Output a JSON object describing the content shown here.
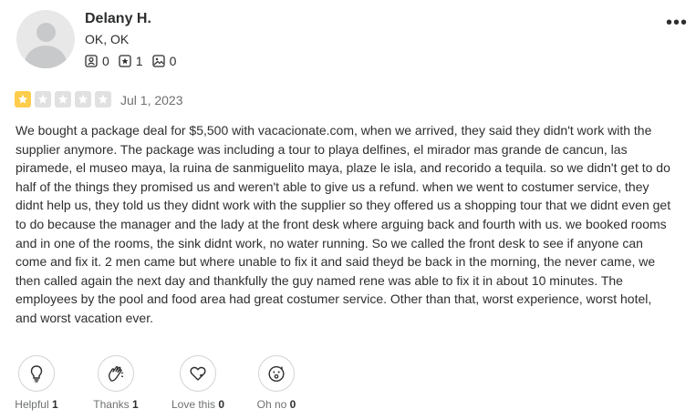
{
  "reviewer": {
    "name": "Delany H.",
    "location": "OK, OK",
    "friends_count": "0",
    "reviews_count": "1",
    "photos_count": "0"
  },
  "review": {
    "rating": 1,
    "rating_max": 5,
    "star_active_color": "#ffcc4b",
    "star_inactive_color": "#e1e1e1",
    "date": "Jul 1, 2023",
    "text": "We bought a package deal for $5,500 with vacacionate.com, when we arrived, they said they didn't work with the supplier anymore. The package was including a tour to playa delfines, el mirador mas grande de cancun, las piramede, el museo maya, la ruina de sanmiguelito maya, plaze le isla, and recorido a tequila. so we didn't get to do half of the things they promised us and weren't able to give us a refund. when we went to costumer service, they didnt help us, they told us they didnt work with the supplier so they offered us a shopping tour that we didnt even get to do because the manager and the lady at the front desk where arguing back and fourth with us. we booked rooms and in one of the rooms, the sink didnt work, no water running. So we called the front desk to see if anyone can come and fix it. 2 men came but where unable to fix it and said theyd be back in the morning, the never came, we then called again the next day and thankfully the guy named rene was able to fix it in about 10 minutes. The employees by the pool and food area had great costumer service. Other than that, worst experience, worst hotel, and worst vacation ever."
  },
  "reactions": [
    {
      "label": "Helpful",
      "count": "1",
      "icon": "lightbulb-icon"
    },
    {
      "label": "Thanks",
      "count": "1",
      "icon": "clapping-hands-icon"
    },
    {
      "label": "Love this",
      "count": "0",
      "icon": "heart-icon"
    },
    {
      "label": "Oh no",
      "count": "0",
      "icon": "surprised-face-icon"
    }
  ]
}
